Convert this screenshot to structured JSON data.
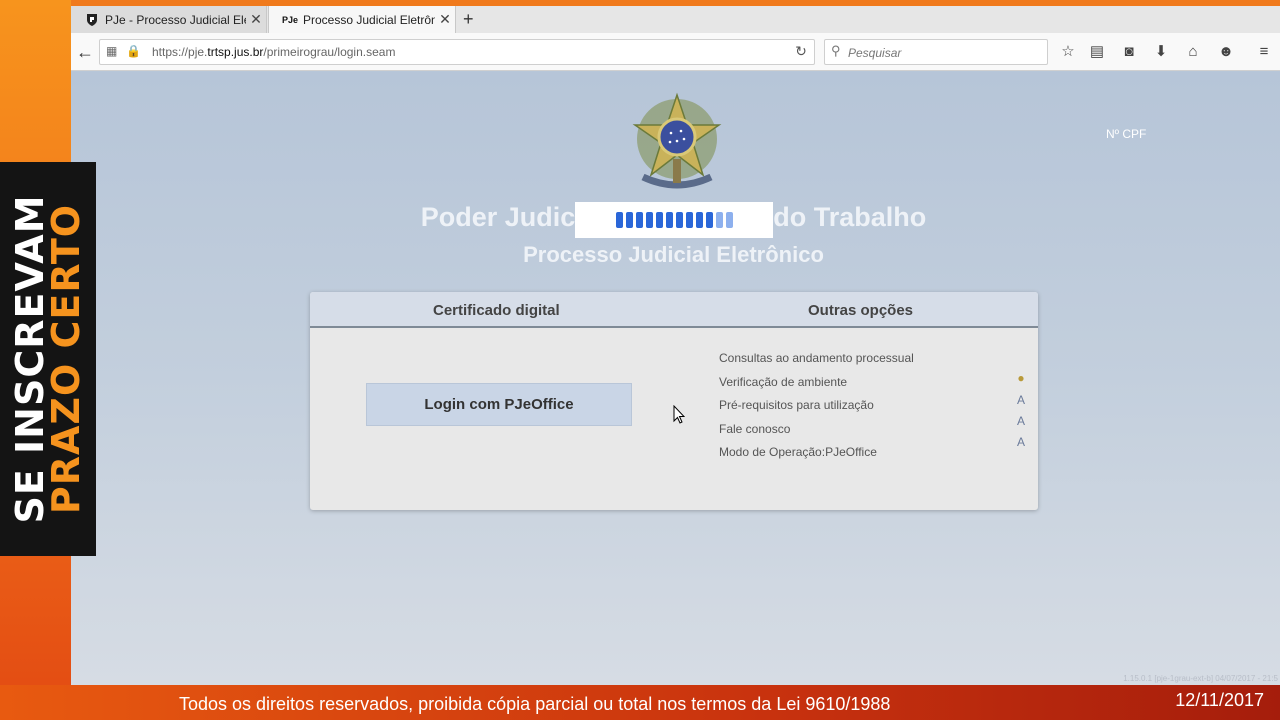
{
  "browser": {
    "tabs": [
      {
        "label": "PJe - Processo Judicial Elet...",
        "icon": "pje-shield-icon"
      },
      {
        "label": "Processo Judicial Eletrônic...",
        "icon": "pje-text-icon",
        "active": true
      }
    ],
    "url_prefix": "https://pje.",
    "url_domain": "trtsp.jus.br",
    "url_path": "/primeirograu/login.seam",
    "search_placeholder": "Pesquisar"
  },
  "page": {
    "cpf_label": "Nº CPF",
    "title_left": "Poder Judic",
    "title_right": "do Trabalho",
    "subtitle": "Processo Judicial Eletrônico",
    "tab_certificate": "Certificado digital",
    "tab_other": "Outras opções",
    "login_button": "Login com PJeOffice",
    "options": [
      "Consultas ao andamento processual",
      "Verificação de ambiente",
      "Pré-requisitos para utilização",
      "Fale conosco",
      "Modo de Operação:PJeOffice"
    ],
    "version": "1.15.0.1 [pje-1grau-ext-b] 04/07/2017 - 21:5"
  },
  "overlay": {
    "banner_line1": "SE INSCREVAM",
    "banner_line2": "PRAZO CERTO",
    "footer_text": "Todos os direitos reservados, proibida cópia parcial ou total nos termos da Lei 9610/1988",
    "footer_date": "12/11/2017"
  }
}
